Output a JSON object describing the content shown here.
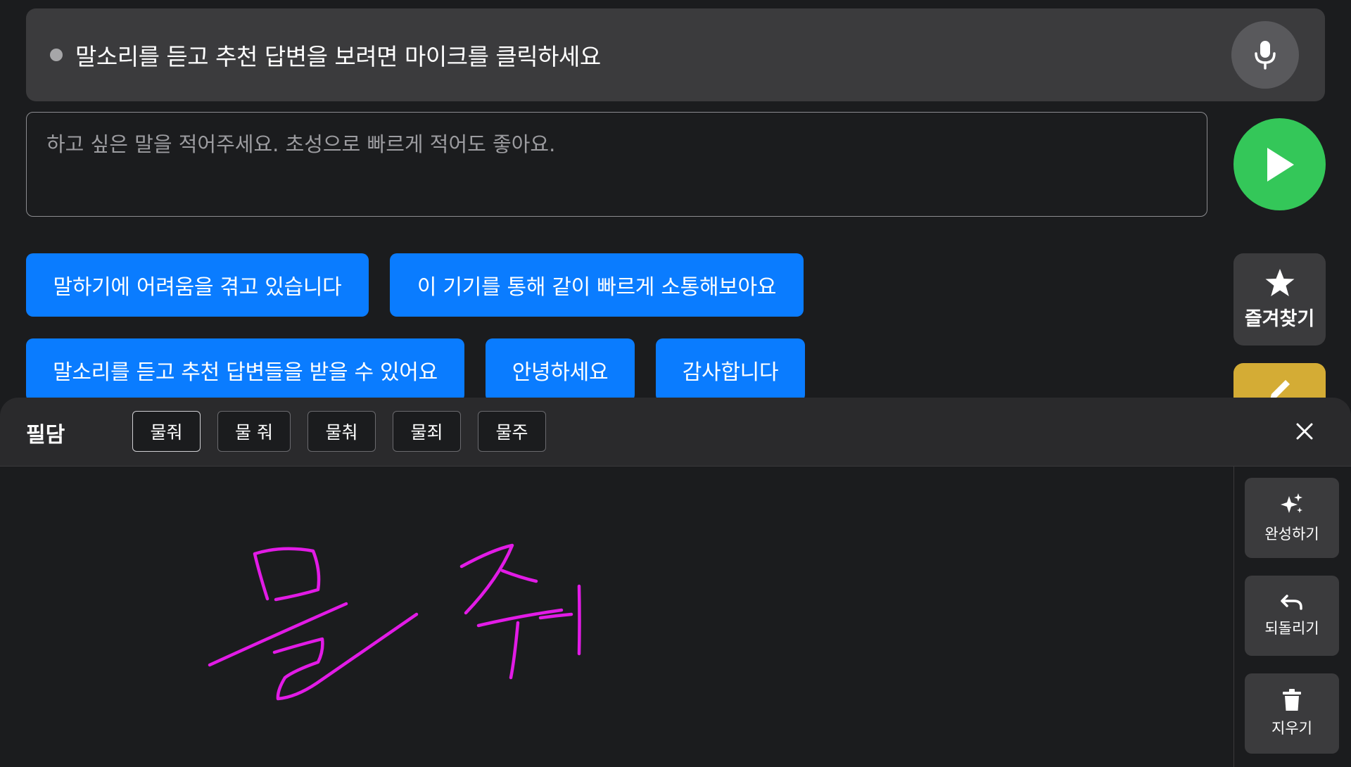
{
  "listen_bar": {
    "status_text": "말소리를 듣고 추천 답변을 보려면 마이크를 클릭하세요",
    "mic_icon": "microphone-icon"
  },
  "text_input": {
    "value": "",
    "placeholder": "하고 싶은 말을 적어주세요. 초성으로 빠르게 적어도 좋아요."
  },
  "send_button": {
    "icon": "play-icon",
    "color": "#34c759"
  },
  "phrases": [
    "말하기에 어려움을 겪고 있습니다",
    "이 기기를 통해 같이 빠르게 소통해보아요",
    "말소리를 듣고 추천 답변들을 받을 수 있어요",
    "안녕하세요",
    "감사합니다"
  ],
  "side_buttons": {
    "favorites": {
      "label": "즐겨찾기",
      "icon": "star-icon"
    },
    "edit": {
      "icon": "pencil-icon",
      "color": "#d4ac35"
    }
  },
  "handwriting": {
    "title": "필담",
    "candidates": [
      "물줘",
      "물 줘",
      "물춰",
      "물죄",
      "물주"
    ],
    "selected_index": 0,
    "close_icon": "close-icon",
    "ink_color": "#e21be6",
    "tools": [
      {
        "label": "완성하기",
        "icon": "sparkles-icon"
      },
      {
        "label": "되돌리기",
        "icon": "undo-icon"
      },
      {
        "label": "지우기",
        "icon": "trash-icon"
      }
    ]
  },
  "colors": {
    "background": "#1b1c1e",
    "chip_blue": "#0a7cff",
    "bar_gray": "#3b3b3d"
  }
}
